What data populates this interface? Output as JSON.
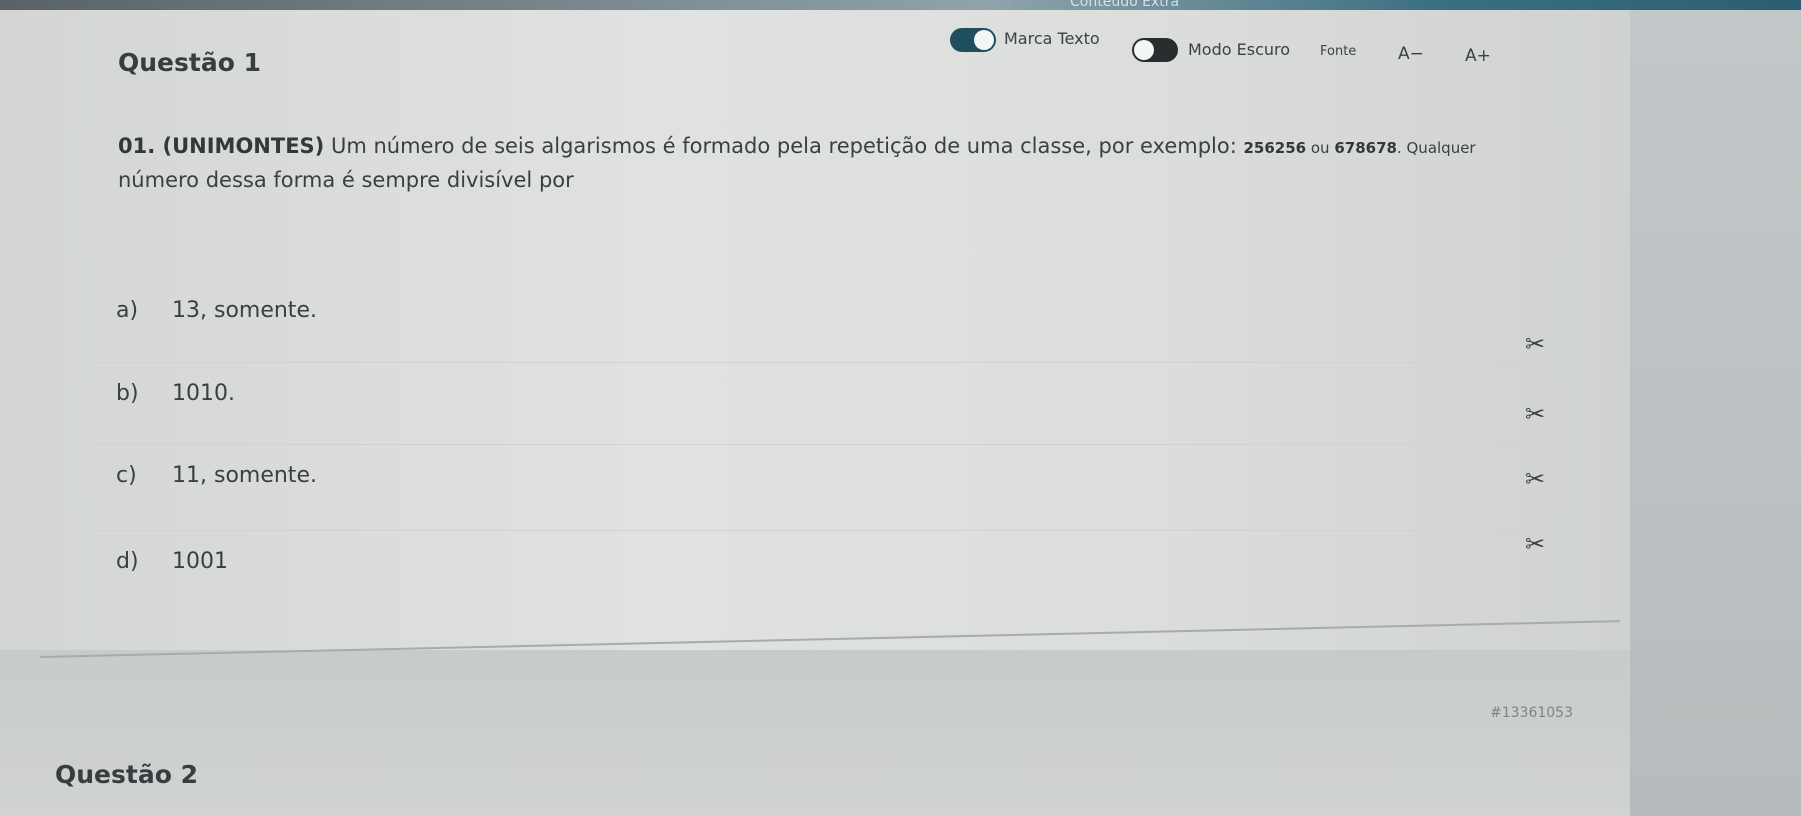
{
  "top_bar": {
    "label": "Conteúdo Extra"
  },
  "question1": {
    "title": "Questão 1",
    "toolbar": {
      "marker_label": "Marca Texto",
      "dark_mode_label": "Modo Escuro",
      "font_label": "Fonte",
      "font_decrease": "A−",
      "font_increase": "A+"
    },
    "statement": {
      "prefix": "01. (UNIMONTES)",
      "text": " Um número de seis algarismos é formado pela repetição de uma classe, por exemplo: ",
      "example1": "256256",
      "connector": " ou ",
      "example2": "678678",
      "after_examples": ". Qualquer",
      "line2": "número dessa forma é sempre divisível por"
    },
    "options": [
      {
        "letter": "a)",
        "text": "13, somente."
      },
      {
        "letter": "b)",
        "text": "1010."
      },
      {
        "letter": "c)",
        "text": "11, somente."
      },
      {
        "letter": "d)",
        "text": "1001"
      }
    ]
  },
  "question2": {
    "title": "Questão 2",
    "id": "#13361053"
  },
  "colors": {
    "toggle_on": "#1f4f5f",
    "toggle_off": "#2a2d30"
  }
}
